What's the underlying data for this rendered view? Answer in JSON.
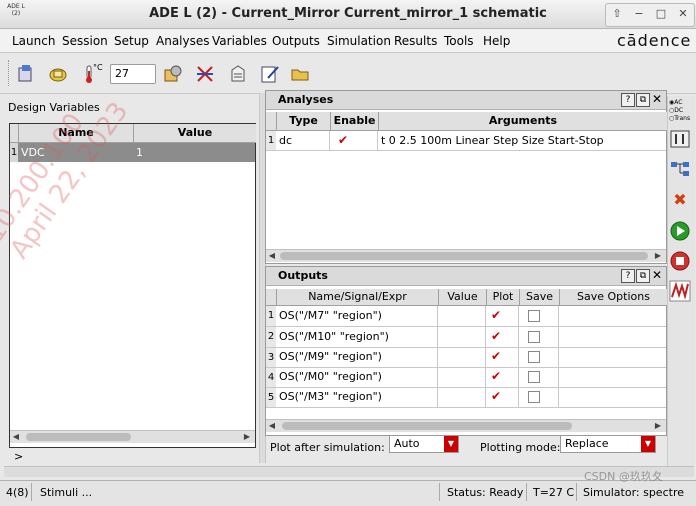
{
  "window": {
    "title": "ADE L (2) - Current_Mirror Current_mirror_1 schematic",
    "logo_text": "ADE L (2)",
    "buttons": [
      "⇧",
      "−",
      "□",
      "✕"
    ]
  },
  "menubar": {
    "items": [
      {
        "label": "Launch"
      },
      {
        "label": "Session"
      },
      {
        "label": "Setup"
      },
      {
        "label": "Analyses"
      },
      {
        "label": "Variables"
      },
      {
        "label": "Outputs"
      },
      {
        "label": "Simulation"
      },
      {
        "label": "Results"
      },
      {
        "label": "Tools"
      },
      {
        "label": "Help"
      }
    ],
    "brand": "cādence"
  },
  "toolbar": {
    "temperature_unit": "°C",
    "temperature_value": "27",
    "icons": [
      "load-state-icon",
      "save-state-icon",
      "thermometer-icon",
      "model-setup-icon",
      "select-on-schematic-icon",
      "netlist-icon",
      "edit-icon",
      "open-folder-icon"
    ]
  },
  "design_variables": {
    "label": "Design Variables",
    "columns": [
      "Name",
      "Value"
    ],
    "rows": [
      {
        "index": "1",
        "name": "VDC",
        "value": "1"
      }
    ],
    "footer": ">"
  },
  "analyses": {
    "title": "Analyses",
    "columns": [
      "Type",
      "Enable",
      "Arguments"
    ],
    "rows": [
      {
        "index": "1",
        "type": "dc",
        "enabled": true,
        "arguments": "t 0 2.5 100m Linear Step Size Start-Stop"
      }
    ]
  },
  "outputs": {
    "title": "Outputs",
    "columns": [
      "Name/Signal/Expr",
      "Value",
      "Plot",
      "Save",
      "Save Options"
    ],
    "rows": [
      {
        "index": "1",
        "name": "OS(\"/M7\" \"region\")",
        "value": "",
        "plot": true,
        "save": false
      },
      {
        "index": "2",
        "name": "OS(\"/M10\" \"region\")",
        "value": "",
        "plot": true,
        "save": false
      },
      {
        "index": "3",
        "name": "OS(\"/M9\" \"region\")",
        "value": "",
        "plot": true,
        "save": false
      },
      {
        "index": "4",
        "name": "OS(\"/M0\" \"region\")",
        "value": "",
        "plot": true,
        "save": false
      },
      {
        "index": "5",
        "name": "OS(\"/M3\" \"region\")",
        "value": "",
        "plot": true,
        "save": false
      }
    ]
  },
  "plot_options": {
    "plot_after_label": "Plot after simulation:",
    "plot_after_value": "Auto",
    "plotting_mode_label": "Plotting mode:",
    "plotting_mode_value": "Replace"
  },
  "side_toolbar": {
    "analysis_radio": [
      "AC",
      "DC",
      "Trans"
    ]
  },
  "statusbar": {
    "count": "4(8)",
    "message": "Stimuli ...",
    "status": "Status: Ready",
    "temperature": "T=27 C",
    "simulator": "Simulator: spectre"
  },
  "watermark": {
    "lines": [
      "10.200.100",
      "April 22, 2023"
    ],
    "corner_text": "CSDN @玖玖夂"
  },
  "colors": {
    "check_red": "#cc0000",
    "selected_row": "#8c8c8c",
    "run_green": "#2a9a2a",
    "stop_red": "#d03030"
  }
}
